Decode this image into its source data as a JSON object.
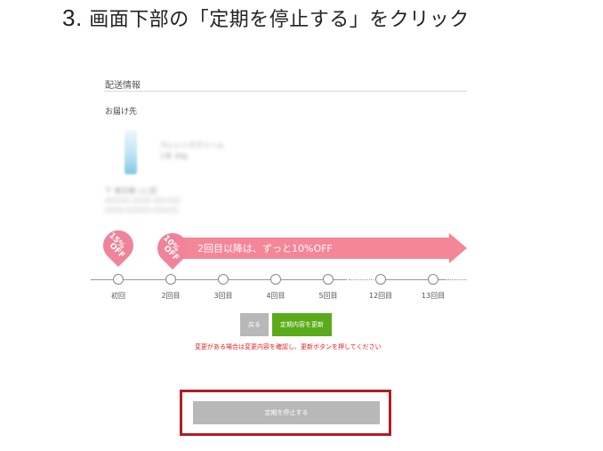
{
  "step": {
    "number": "3.",
    "text": "画面下部の「定期を停止する」をクリック"
  },
  "delivery": {
    "section_title": "配送情報",
    "destination_label": "お届け先",
    "product_name_blurred": "ウレシングクリーム",
    "product_detail_blurred": "1本 30g",
    "address_lines_blurred": [
      "〒 東京都 ○○区",
      "○○○○ ○○○ ○○-○○",
      "○○○-○○○○-○○○○"
    ]
  },
  "campaign": {
    "first_badge": [
      "15%",
      "OFF"
    ],
    "second_badge": [
      "10%",
      "OFF"
    ],
    "banner_text": "2回目以降は、ずっと10%OFF",
    "colors": {
      "badge": "#f08399",
      "arrow": "#f58698"
    }
  },
  "timeline": {
    "labels": [
      "初回",
      "2回目",
      "3回目",
      "4回目",
      "5回目",
      "12回目",
      "13回目"
    ]
  },
  "actions": {
    "back_label": "戻る",
    "update_label": "定期内容を更新",
    "notice": "変更がある場合は変更内容を確認し、更新ボタンを押してください",
    "stop_label": "定期を停止する",
    "colors": {
      "update": "#5aab19",
      "highlight": "#b01e23",
      "notice": "#e0201b"
    }
  }
}
